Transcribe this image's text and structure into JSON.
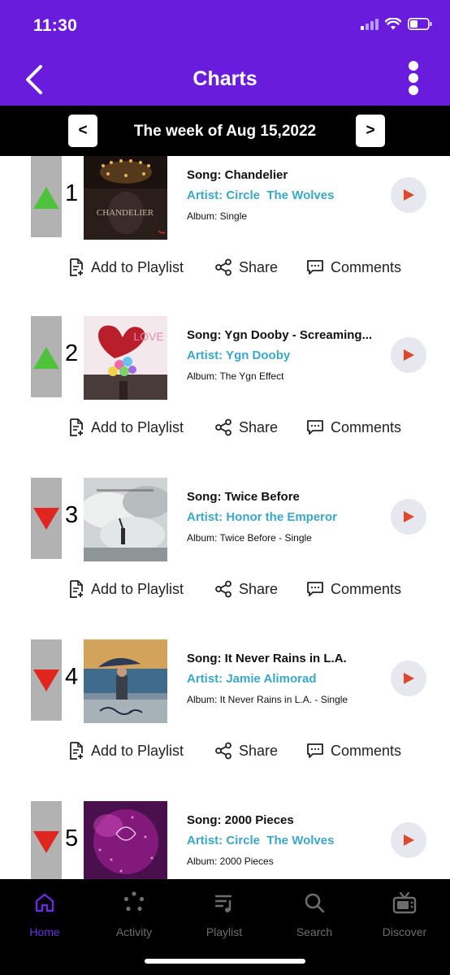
{
  "status_bar": {
    "time": "11:30"
  },
  "header": {
    "title": "Charts"
  },
  "week": {
    "prev_label": "<",
    "next_label": ">",
    "label": "The week of Aug 15,2022"
  },
  "actions": {
    "add_to_playlist": "Add to Playlist",
    "share": "Share",
    "comments": "Comments"
  },
  "entries": [
    {
      "rank": "1",
      "trend": "up",
      "song": "Song: Chandelier",
      "artist": "Artist: Circle  The Wolves",
      "album": "Album: Single",
      "cover_text": "CHANDELIER"
    },
    {
      "rank": "2",
      "trend": "up",
      "song": "Song: Ygn Dooby - Screaming...",
      "artist": "Artist: Ygn Dooby",
      "album": "Album: The Ygn Effect",
      "cover_text": "LOVE"
    },
    {
      "rank": "3",
      "trend": "down",
      "song": "Song: Twice Before",
      "artist": "Artist: Honor the Emperor",
      "album": "Album: Twice Before - Single",
      "cover_text": ""
    },
    {
      "rank": "4",
      "trend": "down",
      "song": "Song: It Never Rains in L.A.",
      "artist": "Artist: Jamie Alimorad",
      "album": "Album: It Never Rains in L.A. - Single",
      "cover_text": ""
    },
    {
      "rank": "5",
      "trend": "down",
      "song": "Song: 2000 Pieces",
      "artist": "Artist: Circle  The Wolves",
      "album": "Album: 2000 Pieces",
      "cover_text": ""
    }
  ],
  "tabs": [
    {
      "label": "Home",
      "icon": "home-icon",
      "active": true
    },
    {
      "label": "Activity",
      "icon": "activity-icon",
      "active": false
    },
    {
      "label": "Playlist",
      "icon": "playlist-icon",
      "active": false
    },
    {
      "label": "Search",
      "icon": "search-icon",
      "active": false
    },
    {
      "label": "Discover",
      "icon": "discover-tv-icon",
      "active": false
    }
  ],
  "colors": {
    "header": "#6a1cdd",
    "artist": "#3aa7c8",
    "trend_up": "#4fc23b",
    "trend_down": "#e0261f",
    "play_icon": "#e0482b",
    "tab_active": "#6a2ee0",
    "tab_inactive": "#6d6d6d"
  }
}
